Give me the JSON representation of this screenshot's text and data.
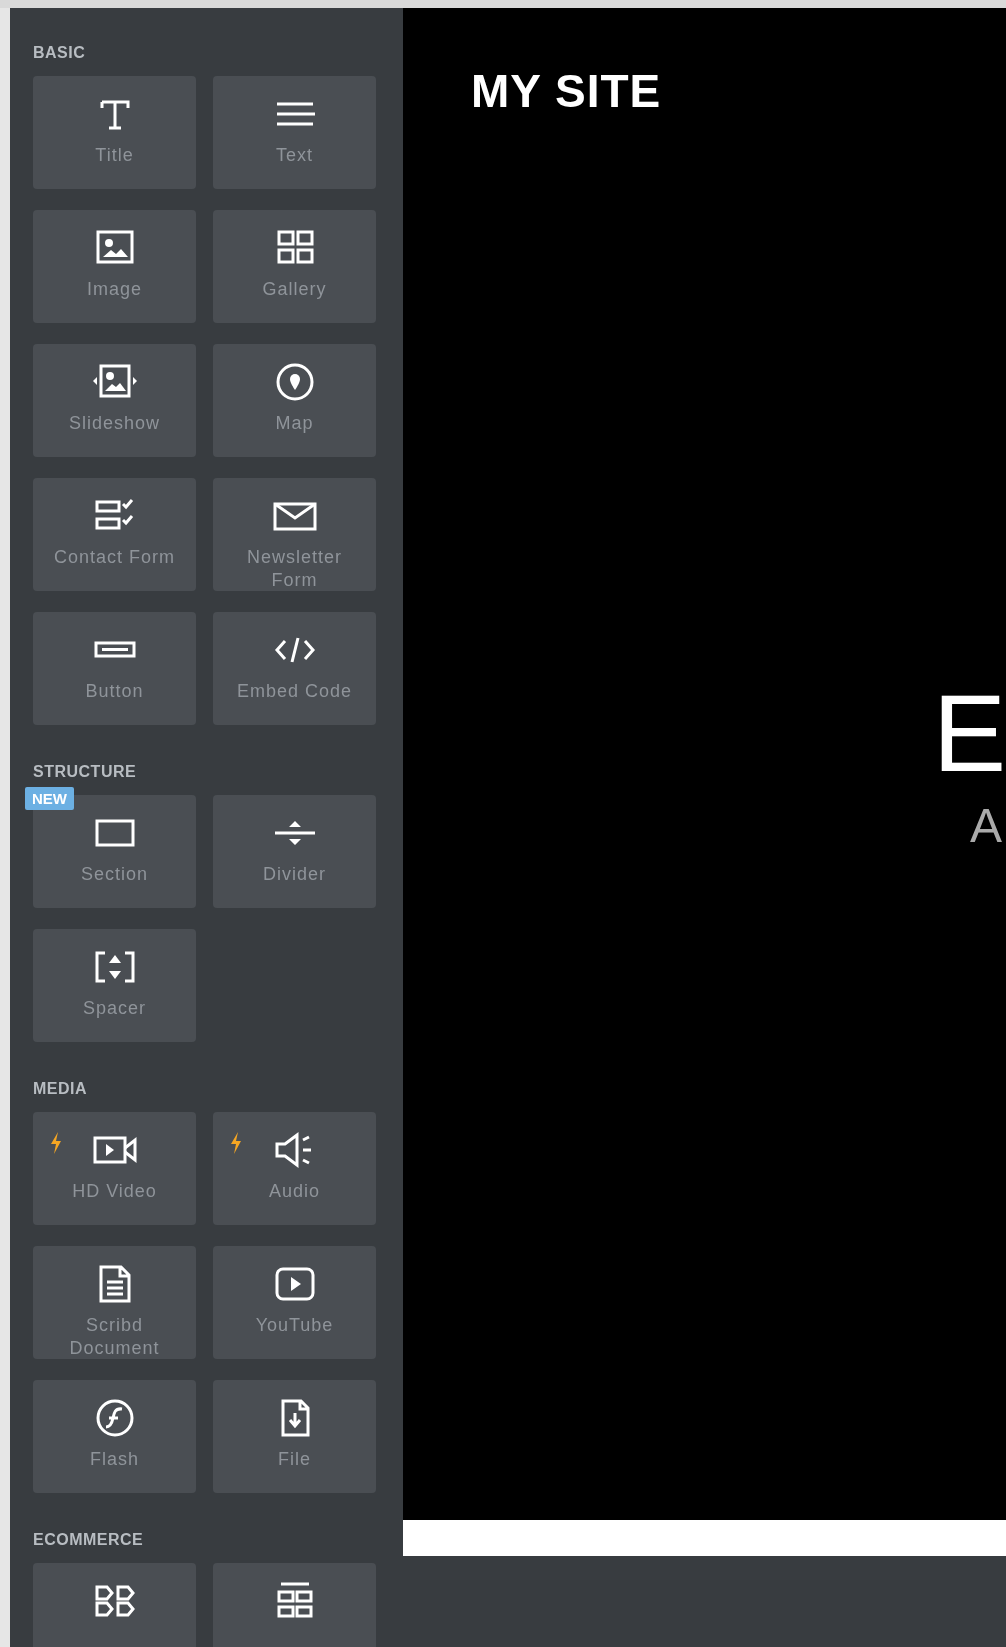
{
  "sidebar": {
    "sections": [
      {
        "title": "BASIC",
        "items": [
          {
            "kind": "title",
            "label": "Title",
            "premium": false
          },
          {
            "kind": "text",
            "label": "Text",
            "premium": false
          },
          {
            "kind": "image",
            "label": "Image",
            "premium": false
          },
          {
            "kind": "gallery",
            "label": "Gallery",
            "premium": false
          },
          {
            "kind": "slideshow",
            "label": "Slideshow",
            "premium": false
          },
          {
            "kind": "map",
            "label": "Map",
            "premium": false
          },
          {
            "kind": "contact",
            "label": "Contact Form",
            "premium": false
          },
          {
            "kind": "newsletter",
            "label": "Newsletter Form",
            "premium": false
          },
          {
            "kind": "button",
            "label": "Button",
            "premium": false
          },
          {
            "kind": "code",
            "label": "Embed Code",
            "premium": false
          }
        ]
      },
      {
        "title": "STRUCTURE",
        "items": [
          {
            "kind": "section",
            "label": "Section",
            "premium": false,
            "badge": "NEW"
          },
          {
            "kind": "divider",
            "label": "Divider",
            "premium": false
          },
          {
            "kind": "spacer",
            "label": "Spacer",
            "premium": false
          }
        ]
      },
      {
        "title": "MEDIA",
        "items": [
          {
            "kind": "video",
            "label": "HD Video",
            "premium": true
          },
          {
            "kind": "audio",
            "label": "Audio",
            "premium": true
          },
          {
            "kind": "document",
            "label": "Scribd Document",
            "premium": false
          },
          {
            "kind": "youtube",
            "label": "YouTube",
            "premium": false
          },
          {
            "kind": "flash",
            "label": "Flash",
            "premium": false
          },
          {
            "kind": "file",
            "label": "File",
            "premium": false
          }
        ]
      },
      {
        "title": "ECOMMERCE",
        "items": [
          {
            "kind": "tags",
            "premium": false
          },
          {
            "kind": "grid",
            "premium": false
          }
        ]
      }
    ]
  },
  "canvas": {
    "site_title": "MY SITE",
    "heading": "E",
    "subheading": "A"
  }
}
